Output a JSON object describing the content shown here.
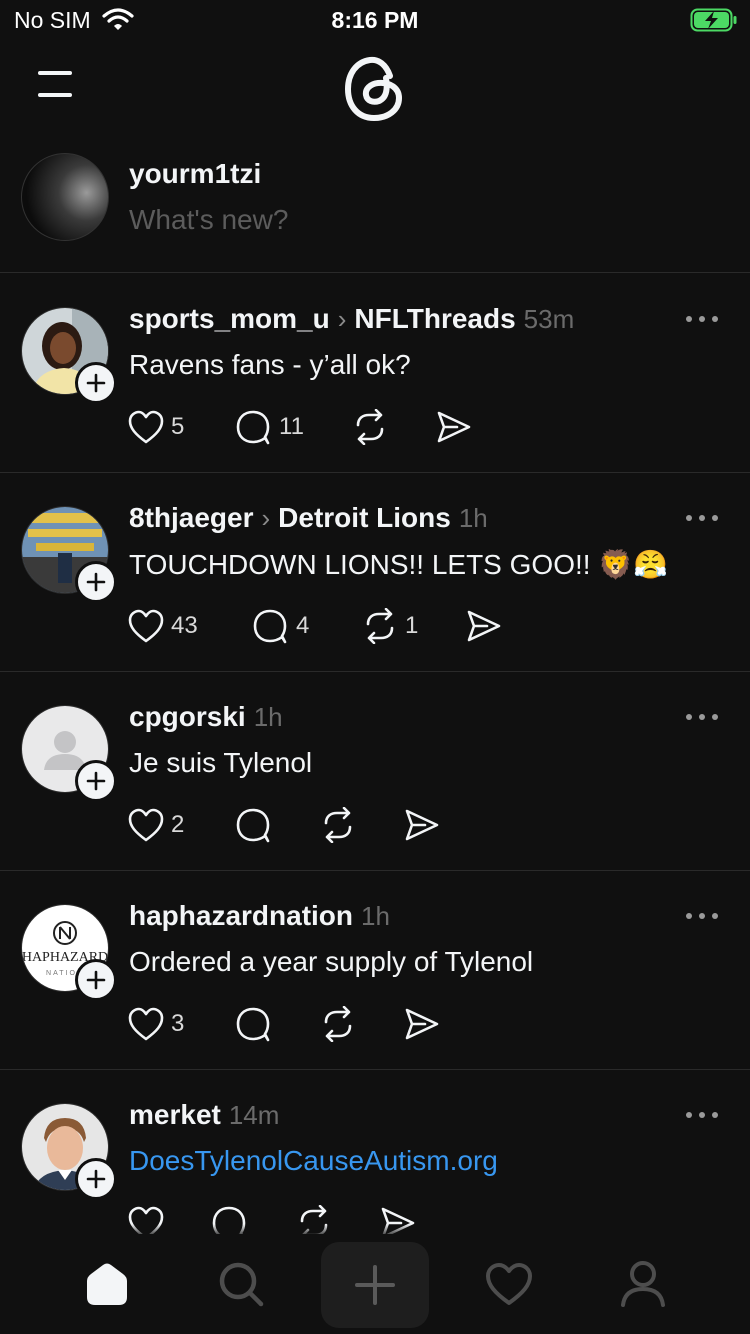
{
  "status_bar": {
    "carrier": "No SIM",
    "time": "8:16 PM",
    "battery_state": "charging"
  },
  "header": {
    "menu_icon": "hamburger-menu-icon",
    "logo_icon": "threads-logo-icon"
  },
  "composer": {
    "username": "yourm1tzi",
    "placeholder": "What's new?"
  },
  "posts": [
    {
      "author": "sports_mom_u",
      "community": "NFLThreads",
      "time": "53m",
      "text": "Ravens fans - y’all ok?",
      "likes": "5",
      "replies": "11",
      "reposts": ""
    },
    {
      "author": "8thjaeger",
      "community": "Detroit Lions",
      "time": "1h",
      "text": "TOUCHDOWN LIONS!! LETS GOO!! 🦁😤",
      "likes": "43",
      "replies": "4",
      "reposts": "1"
    },
    {
      "author": "cpgorski",
      "community": "",
      "time": "1h",
      "text": "Je suis Tylenol",
      "likes": "2",
      "replies": "",
      "reposts": ""
    },
    {
      "author": "haphazardnation",
      "community": "",
      "time": "1h",
      "text": "Ordered a year supply of Tylenol",
      "likes": "3",
      "replies": "",
      "reposts": "",
      "avatar_text": "HAPHAZARD",
      "avatar_subtext": "NATION"
    },
    {
      "author": "merket",
      "community": "",
      "time": "14m",
      "text": "DoesTylenolCauseAutism.org",
      "likes": "",
      "replies": "",
      "reposts": "",
      "text_is_link": true
    }
  ],
  "bottom_nav": [
    "home-icon",
    "search-icon",
    "create-icon",
    "activity-heart-icon",
    "profile-icon"
  ],
  "colors": {
    "background": "#101010",
    "link": "#3897f0",
    "muted": "#6b6b6b",
    "battery": "#4cd964"
  }
}
